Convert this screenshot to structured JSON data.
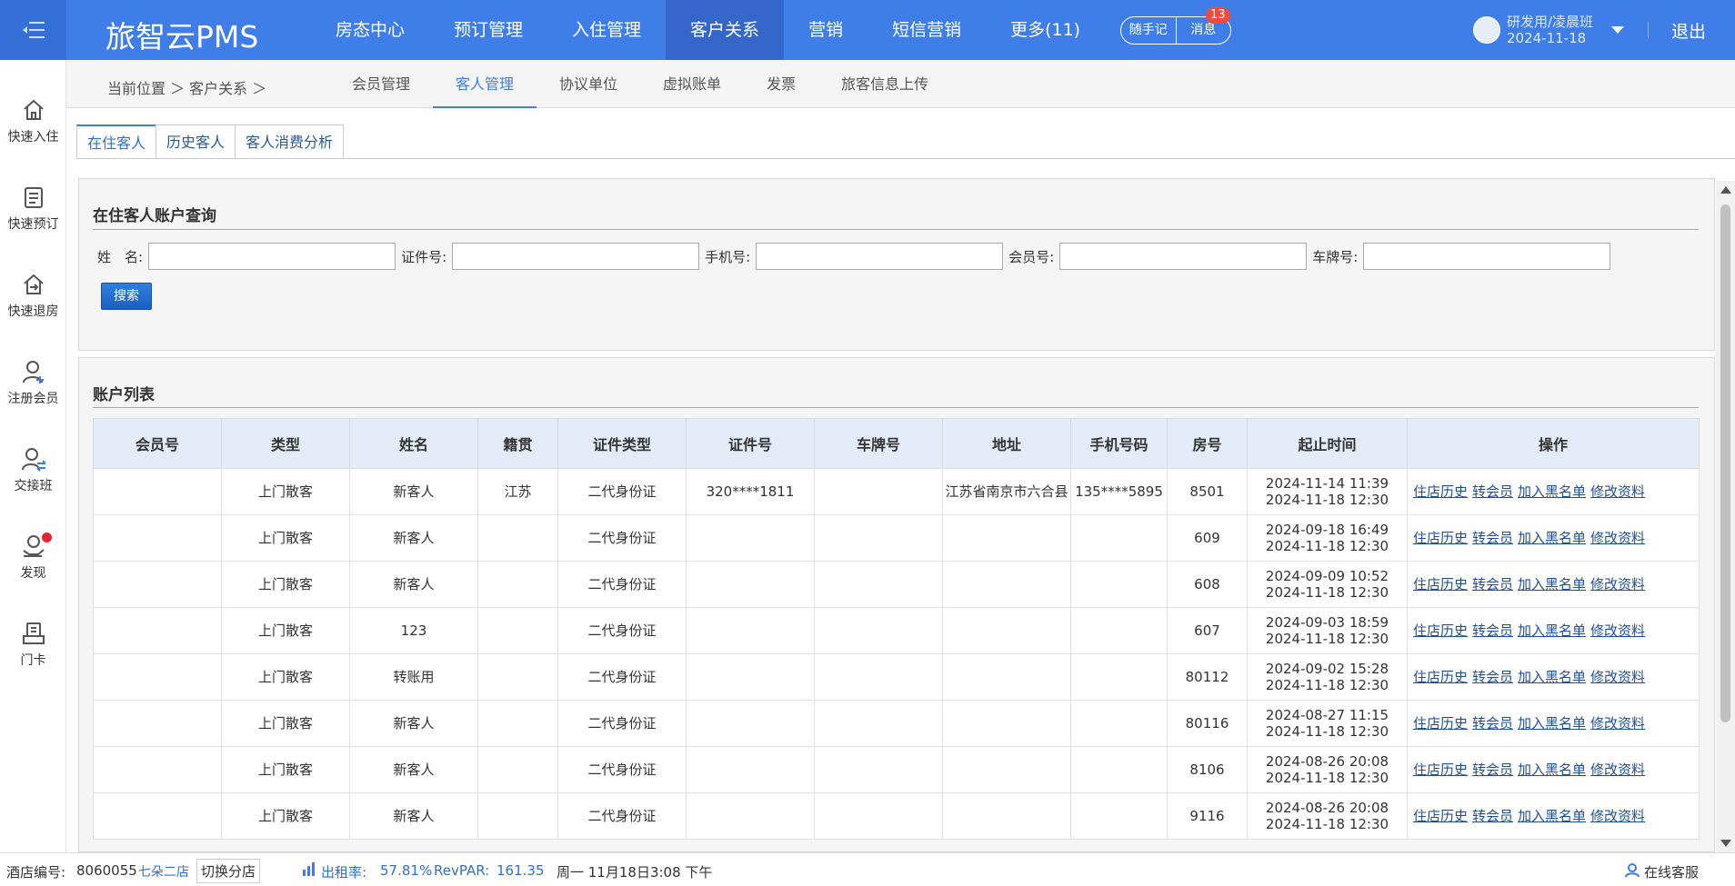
{
  "app": {
    "brand": "旅智云PMS",
    "nav": [
      "房态中心",
      "预订管理",
      "入住管理",
      "客户关系",
      "营销",
      "短信营销",
      "更多(11)"
    ],
    "active_nav": "客户关系",
    "notes_label": "随手记",
    "messages_label": "消息",
    "messages_badge": "13",
    "user_name": "研发用/凌晨班",
    "user_date": "2024-11-18",
    "logout_label": "退出"
  },
  "sidebar": [
    "快速入住",
    "快速预订",
    "快速退房",
    "注册会员",
    "交接班",
    "发现",
    "门卡"
  ],
  "breadcrumb": "当前位置 ＞ 客户关系 ＞",
  "subtabs": [
    "会员管理",
    "客人管理",
    "协议单位",
    "虚拟账单",
    "发票",
    "旅客信息上传"
  ],
  "inner_tabs": [
    "在住客人",
    "历史客人",
    "客人消费分析"
  ],
  "query": {
    "title": "在住客人账户查询",
    "fields": [
      "姓　名:",
      "证件号:",
      "手机号:",
      "会员号:",
      "车牌号:"
    ],
    "search_label": "搜索"
  },
  "list": {
    "title": "账户列表",
    "columns": [
      "会员号",
      "类型",
      "姓名",
      "籍贯",
      "证件类型",
      "证件号",
      "车牌号",
      "地址",
      "手机号码",
      "房号",
      "起止时间",
      "操作"
    ],
    "ops": [
      "住店历史",
      "转会员",
      "加入黑名单",
      "修改资料"
    ],
    "rows": [
      {
        "member": "",
        "type": "上门散客",
        "name": "新客人",
        "origin": "江苏",
        "idtype": "二代身份证",
        "idno": "320****1811",
        "plate": "",
        "addr": "江苏省南京市六合县",
        "phone": "135****5895",
        "room": "8501",
        "start": "2024-11-14 11:39",
        "end": "2024-11-18 12:30"
      },
      {
        "member": "",
        "type": "上门散客",
        "name": "新客人",
        "origin": "",
        "idtype": "二代身份证",
        "idno": "",
        "plate": "",
        "addr": "",
        "phone": "",
        "room": "609",
        "start": "2024-09-18 16:49",
        "end": "2024-11-18 12:30"
      },
      {
        "member": "",
        "type": "上门散客",
        "name": "新客人",
        "origin": "",
        "idtype": "二代身份证",
        "idno": "",
        "plate": "",
        "addr": "",
        "phone": "",
        "room": "608",
        "start": "2024-09-09 10:52",
        "end": "2024-11-18 12:30"
      },
      {
        "member": "",
        "type": "上门散客",
        "name": "123",
        "origin": "",
        "idtype": "二代身份证",
        "idno": "",
        "plate": "",
        "addr": "",
        "phone": "",
        "room": "607",
        "start": "2024-09-03 18:59",
        "end": "2024-11-18 12:30"
      },
      {
        "member": "",
        "type": "上门散客",
        "name": "转账用",
        "origin": "",
        "idtype": "二代身份证",
        "idno": "",
        "plate": "",
        "addr": "",
        "phone": "",
        "room": "80112",
        "start": "2024-09-02 15:28",
        "end": "2024-11-18 12:30"
      },
      {
        "member": "",
        "type": "上门散客",
        "name": "新客人",
        "origin": "",
        "idtype": "二代身份证",
        "idno": "",
        "plate": "",
        "addr": "",
        "phone": "",
        "room": "80116",
        "start": "2024-08-27 11:15",
        "end": "2024-11-18 12:30"
      },
      {
        "member": "",
        "type": "上门散客",
        "name": "新客人",
        "origin": "",
        "idtype": "二代身份证",
        "idno": "",
        "plate": "",
        "addr": "",
        "phone": "",
        "room": "8106",
        "start": "2024-08-26 20:08",
        "end": "2024-11-18 12:30"
      },
      {
        "member": "",
        "type": "上门散客",
        "name": "新客人",
        "origin": "",
        "idtype": "二代身份证",
        "idno": "",
        "plate": "",
        "addr": "",
        "phone": "",
        "room": "9116",
        "start": "2024-08-26 20:08",
        "end": "2024-11-18 12:30"
      }
    ]
  },
  "footer": {
    "hotel_label": "酒店编号:",
    "hotel_no": "8060055",
    "branch": "七朵二店",
    "switch_label": "切换分店",
    "occupancy": "出租率:",
    "occupancy_val": "57.81%",
    "revpar": "RevPAR:",
    "revpar_val": "161.35",
    "datetime": "周一 11月18日3:08 下午",
    "support": "在线客服"
  },
  "colors": {
    "primary": "#3f7de9",
    "active_nav": "#3566c9",
    "link": "#1f4f9a"
  }
}
